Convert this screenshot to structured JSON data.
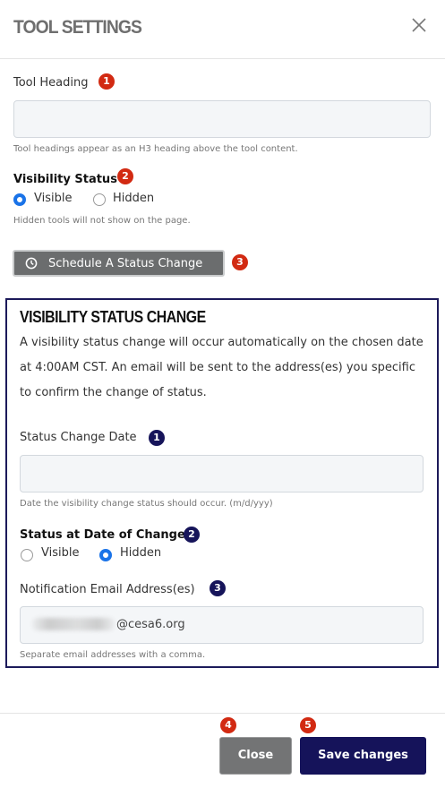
{
  "modal": {
    "title": "TOOL SETTINGS",
    "close_icon": "close-x-icon"
  },
  "tool_heading": {
    "label": "Tool Heading",
    "badge": "1",
    "value": "",
    "placeholder": "",
    "help": "Tool headings appear as an H3 heading above the tool content."
  },
  "visibility": {
    "label": "Visibility Status",
    "badge": "2",
    "options": [
      "Visible",
      "Hidden"
    ],
    "selected": "Visible",
    "help": "Hidden tools will not show on the page."
  },
  "schedule": {
    "label": "Schedule A Status Change",
    "icon": "clock-icon",
    "badge": "3"
  },
  "status_change": {
    "title": "VISIBILITY STATUS CHANGE",
    "description": "A visibility status change will occur automatically on the chosen date at 4:00AM CST. An email will be sent to the address(es) you specific to confirm the change of status.",
    "date": {
      "label": "Status Change Date",
      "badge": "1",
      "value": "",
      "help": "Date the visibility change status should occur. (m/d/yyy)"
    },
    "status_at_change": {
      "label": "Status at Date of Change",
      "badge": "2",
      "options": [
        "Visible",
        "Hidden"
      ],
      "selected": "Hidden"
    },
    "email": {
      "label": "Notification Email Address(es)",
      "badge": "3",
      "value_suffix": "@cesa6.org",
      "help": "Separate email addresses with a comma."
    }
  },
  "footer": {
    "close_label": "Close",
    "close_badge": "4",
    "save_label": "Save changes",
    "save_badge": "5"
  },
  "colors": {
    "badge_red": "#d22a12",
    "badge_navy": "#16145a",
    "primary": "#15135a",
    "secondary": "#737475",
    "radio_accent": "#1a73e8"
  }
}
